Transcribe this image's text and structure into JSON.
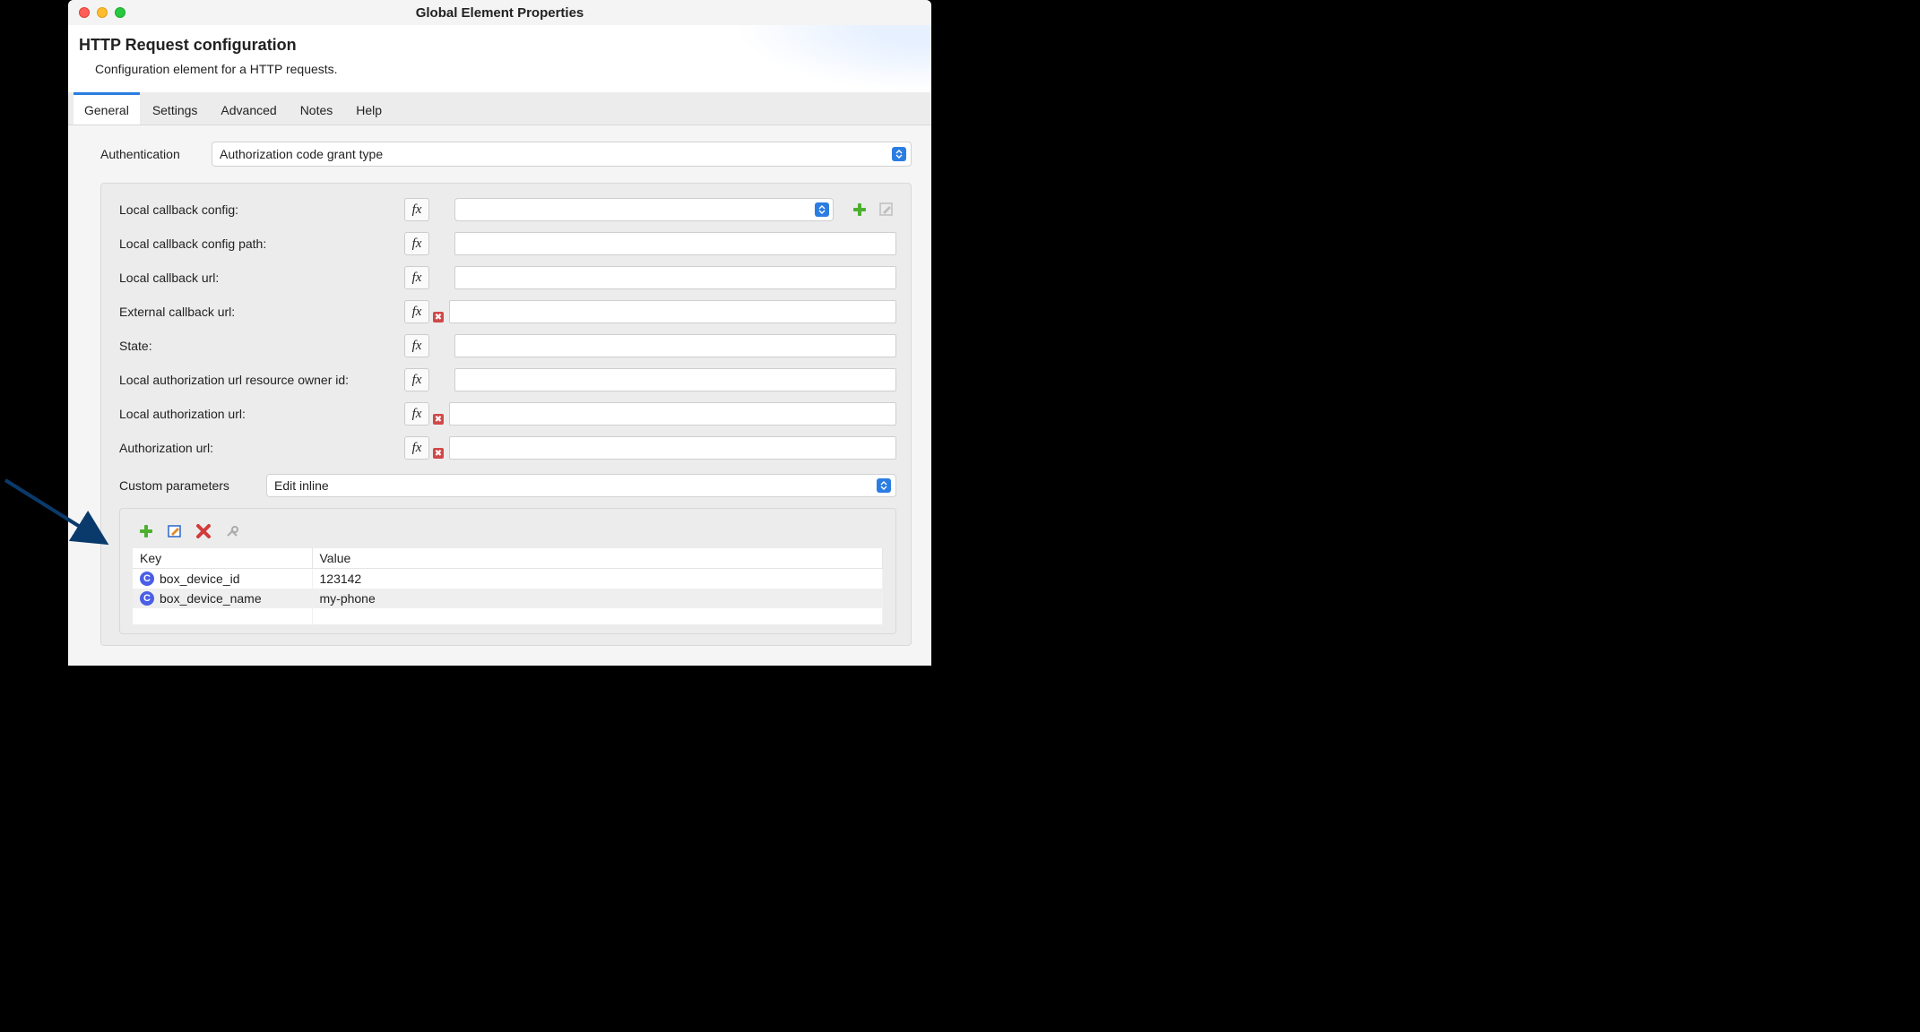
{
  "window": {
    "title": "Global Element Properties"
  },
  "header": {
    "title": "HTTP Request configuration",
    "subtitle": "Configuration element for a HTTP requests."
  },
  "tabs": [
    "General",
    "Settings",
    "Advanced",
    "Notes",
    "Help"
  ],
  "auth": {
    "label": "Authentication",
    "value": "Authorization code grant type"
  },
  "fields": [
    {
      "label": "Local callback config:",
      "type": "select",
      "value": "",
      "error": false,
      "tail": true
    },
    {
      "label": "Local callback config path:",
      "type": "text",
      "value": "",
      "error": false
    },
    {
      "label": "Local callback url:",
      "type": "text",
      "value": "",
      "error": false
    },
    {
      "label": "External callback url:",
      "type": "text",
      "value": "",
      "error": true
    },
    {
      "label": "State:",
      "type": "text",
      "value": "",
      "error": false
    },
    {
      "label": "Local authorization url resource owner id:",
      "type": "text",
      "value": "",
      "error": false
    },
    {
      "label": "Local authorization url:",
      "type": "text",
      "value": "",
      "error": true
    },
    {
      "label": "Authorization url:",
      "type": "text",
      "value": "",
      "error": true
    }
  ],
  "custom": {
    "label": "Custom parameters",
    "mode": "Edit inline"
  },
  "table": {
    "headers": [
      "Key",
      "Value"
    ],
    "rows": [
      {
        "key": "box_device_id",
        "value": "123142"
      },
      {
        "key": "box_device_name",
        "value": "my-phone"
      }
    ]
  },
  "fx": "fx"
}
